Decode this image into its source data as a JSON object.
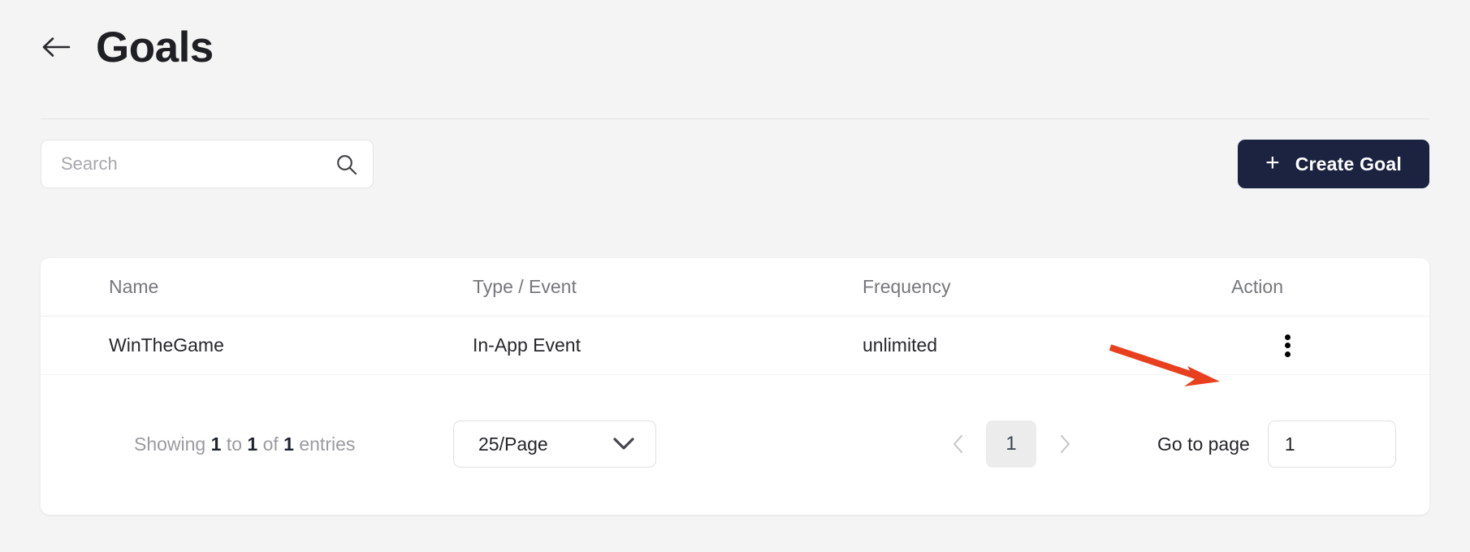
{
  "header": {
    "back_icon": "arrow-left-icon",
    "title": "Goals"
  },
  "toolbar": {
    "search_placeholder": "Search",
    "search_value": "",
    "search_icon": "search-icon",
    "create_goal_label": "Create Goal",
    "create_goal_icon": "plus-icon",
    "create_goal_bg": "#1b2340"
  },
  "table": {
    "columns": [
      {
        "key": "name",
        "label": "Name"
      },
      {
        "key": "type",
        "label": "Type / Event"
      },
      {
        "key": "frequency",
        "label": "Frequency"
      },
      {
        "key": "action",
        "label": "Action"
      }
    ],
    "rows": [
      {
        "name": "WinTheGame",
        "type": "In-App Event",
        "frequency": "unlimited",
        "action_icon": "more-vertical-icon"
      }
    ]
  },
  "pagination": {
    "showing_prefix": "Showing",
    "showing_from": "1",
    "showing_to_word": "to",
    "showing_to": "1",
    "showing_of_word": "of",
    "showing_total": "1",
    "showing_suffix": "entries",
    "per_page_value": "25/Page",
    "per_page_icon": "chevron-down-icon",
    "prev_icon": "chevron-left-icon",
    "next_icon": "chevron-right-icon",
    "current_page": "1",
    "goto_label": "Go to page",
    "goto_value": "1"
  },
  "annotation": {
    "arrow_color": "#e8401f",
    "points_to": "more-vertical-icon"
  }
}
